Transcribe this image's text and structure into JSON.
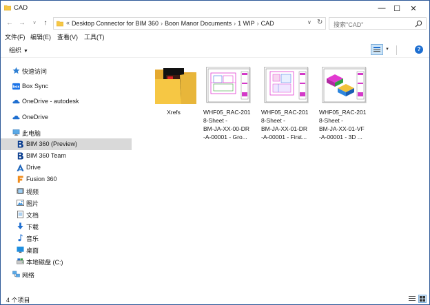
{
  "window": {
    "title": "CAD",
    "minimize_glyph": "—",
    "maximize_glyph": "☐",
    "close_glyph": "✕"
  },
  "nav": {
    "back_glyph": "←",
    "forward_glyph": "→",
    "recent_glyph": "∨",
    "up_glyph": "↑"
  },
  "address": {
    "breadcrumb": [
      "Desktop Connector for BIM 360",
      "Boon Manor Documents",
      "1 WIP",
      "CAD"
    ],
    "lead_sep": "«",
    "dropdown_glyph": "∨",
    "refresh_glyph": "↻"
  },
  "search": {
    "placeholder": "搜索\"CAD\""
  },
  "menu": {
    "file": "文件(F)",
    "edit": "编辑(E)",
    "view": "查看(V)",
    "tools": "工具(T)"
  },
  "toolbar": {
    "organize": "组织",
    "organize_caret": "▼",
    "view_dd": "▾",
    "help": "?"
  },
  "sidebar": {
    "items": [
      {
        "label": "快速访问",
        "icon": "star-icon"
      },
      {
        "label": "Box Sync",
        "icon": "box-icon"
      },
      {
        "label": "OneDrive - autodesk",
        "icon": "onedrive-icon"
      },
      {
        "label": "OneDrive",
        "icon": "onedrive-icon"
      },
      {
        "label": "此电脑",
        "icon": "computer-icon"
      },
      {
        "label": "BIM 360 (Preview)",
        "icon": "bim360-icon"
      },
      {
        "label": "BIM 360 Team",
        "icon": "bim360-icon"
      },
      {
        "label": "Drive",
        "icon": "drive-icon"
      },
      {
        "label": "Fusion 360",
        "icon": "fusion-icon"
      },
      {
        "label": "视频",
        "icon": "video-icon"
      },
      {
        "label": "图片",
        "icon": "pictures-icon"
      },
      {
        "label": "文档",
        "icon": "documents-icon"
      },
      {
        "label": "下载",
        "icon": "download-icon"
      },
      {
        "label": "音乐",
        "icon": "music-icon"
      },
      {
        "label": "桌面",
        "icon": "desktop-icon"
      },
      {
        "label": "本地磁盘 (C:)",
        "icon": "disk-icon"
      },
      {
        "label": "网络",
        "icon": "network-icon"
      }
    ]
  },
  "files": [
    {
      "name": "Xrefs",
      "type": "folder"
    },
    {
      "name": "WHF05_RAC-2018-Sheet - BM-JA-XX-00-DR-A-00001 - Gro...",
      "type": "drawing",
      "lines": [
        "WHF05_RAC-201",
        "8-Sheet -",
        "BM-JA-XX-00-DR",
        "-A-00001 - Gro..."
      ]
    },
    {
      "name": "WHF05_RAC-2018-Sheet - BM-JA-XX-01-DR-A-00001 - First...",
      "type": "drawing",
      "lines": [
        "WHF05_RAC-201",
        "8-Sheet -",
        "BM-JA-XX-01-DR",
        "-A-00001 - First..."
      ]
    },
    {
      "name": "WHF05_RAC-2018-Sheet - BM-JA-XX-01-VF-A-00001 - 3D ...",
      "type": "drawing",
      "lines": [
        "WHF05_RAC-201",
        "8-Sheet -",
        "BM-JA-XX-01-VF",
        "-A-00001 - 3D ..."
      ]
    }
  ],
  "status": {
    "count": "4 个项目"
  },
  "colors": {
    "selection": "#d9d9d9",
    "accent": "#1e6fd1",
    "folder": "#f6c744"
  }
}
